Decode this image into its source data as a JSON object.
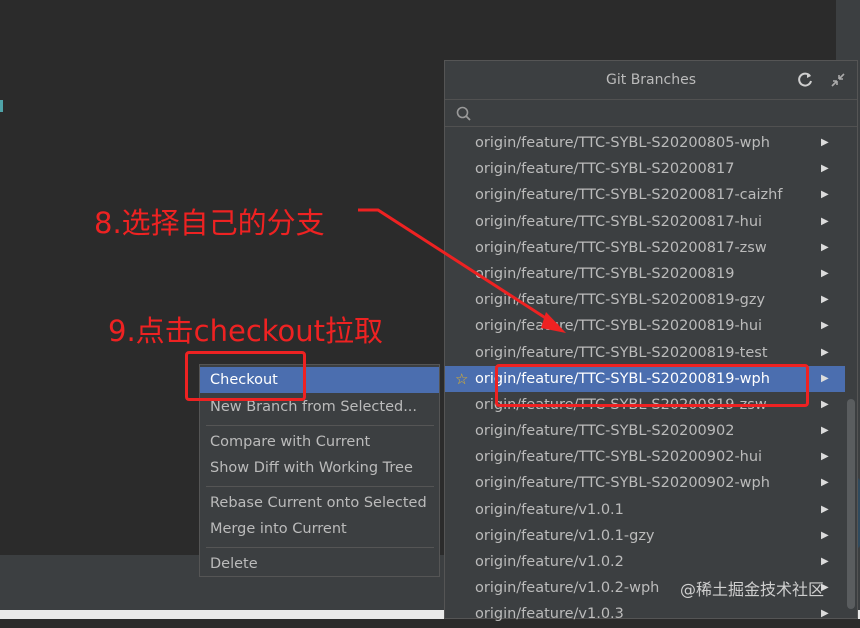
{
  "popup": {
    "title": "Git Branches",
    "search_placeholder": "",
    "branches": [
      {
        "label": "origin/feature/TTC-SYBL-S20200805-wph",
        "selected": false,
        "favorite": false
      },
      {
        "label": "origin/feature/TTC-SYBL-S20200817",
        "selected": false,
        "favorite": false
      },
      {
        "label": "origin/feature/TTC-SYBL-S20200817-caizhf",
        "selected": false,
        "favorite": false
      },
      {
        "label": "origin/feature/TTC-SYBL-S20200817-hui",
        "selected": false,
        "favorite": false
      },
      {
        "label": "origin/feature/TTC-SYBL-S20200817-zsw",
        "selected": false,
        "favorite": false
      },
      {
        "label": "origin/feature/TTC-SYBL-S20200819",
        "selected": false,
        "favorite": false
      },
      {
        "label": "origin/feature/TTC-SYBL-S20200819-gzy",
        "selected": false,
        "favorite": false
      },
      {
        "label": "origin/feature/TTC-SYBL-S20200819-hui",
        "selected": false,
        "favorite": false
      },
      {
        "label": "origin/feature/TTC-SYBL-S20200819-test",
        "selected": false,
        "favorite": false
      },
      {
        "label": "origin/feature/TTC-SYBL-S20200819-wph",
        "selected": true,
        "favorite": true
      },
      {
        "label": "origin/feature/TTC-SYBL-S20200819-zsw",
        "selected": false,
        "favorite": false
      },
      {
        "label": "origin/feature/TTC-SYBL-S20200902",
        "selected": false,
        "favorite": false
      },
      {
        "label": "origin/feature/TTC-SYBL-S20200902-hui",
        "selected": false,
        "favorite": false
      },
      {
        "label": "origin/feature/TTC-SYBL-S20200902-wph",
        "selected": false,
        "favorite": false
      },
      {
        "label": "origin/feature/v1.0.1",
        "selected": false,
        "favorite": false
      },
      {
        "label": "origin/feature/v1.0.1-gzy",
        "selected": false,
        "favorite": false
      },
      {
        "label": "origin/feature/v1.0.2",
        "selected": false,
        "favorite": false
      },
      {
        "label": "origin/feature/v1.0.2-wph",
        "selected": false,
        "favorite": false
      },
      {
        "label": "origin/feature/v1.0.3",
        "selected": false,
        "favorite": false
      }
    ],
    "icons": {
      "refresh": "refresh-icon",
      "collapse": "collapse-icon",
      "search": "search-icon",
      "star": "star-icon",
      "arrow": "submenu-arrow-icon"
    }
  },
  "context_menu": {
    "items": [
      {
        "label": "Checkout",
        "selected": true
      },
      {
        "label": "New Branch from Selected...",
        "selected": false
      },
      {
        "label": "Compare with Current",
        "selected": false
      },
      {
        "label": "Show Diff with Working Tree",
        "selected": false
      },
      {
        "label": "Rebase Current onto Selected",
        "selected": false
      },
      {
        "label": "Merge into Current",
        "selected": false
      },
      {
        "label": "Delete",
        "selected": false
      }
    ]
  },
  "annotations": {
    "step8": "8.选择自己的分支",
    "step9": "9.点击checkout拉取",
    "color": "#ee2222"
  },
  "watermark": "@稀土掘金技术社区",
  "colors": {
    "editor_bg": "#2b2b2b",
    "popup_bg": "#3c3f41",
    "selection": "#4b6eaf",
    "text": "#bbbbbb"
  }
}
